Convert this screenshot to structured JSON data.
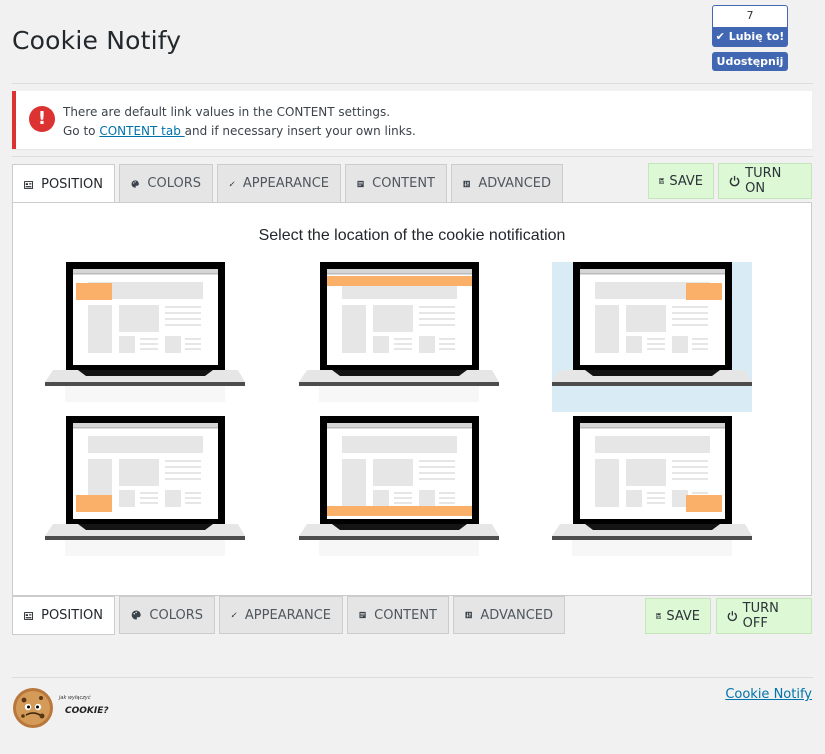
{
  "page": {
    "title": "Cookie Notify"
  },
  "facebook": {
    "count": "7",
    "like_label": "Lubię to!",
    "share_label": "Udostępnij",
    "color": "#4267b2"
  },
  "notice": {
    "line1": "There are default link values in the CONTENT settings.",
    "line2_before": "Go to ",
    "line2_link": "CONTENT tab ",
    "line2_after": "and if necessary insert your own links.",
    "icon": "exclamation-icon"
  },
  "tabs": [
    {
      "label": "POSITION",
      "icon": "position-icon",
      "active": true
    },
    {
      "label": "COLORS",
      "icon": "palette-icon",
      "active": false
    },
    {
      "label": "APPEARANCE",
      "icon": "brush-icon",
      "active": false
    },
    {
      "label": "CONTENT",
      "icon": "content-icon",
      "active": false
    },
    {
      "label": "ADVANCED",
      "icon": "sliders-icon",
      "active": false
    }
  ],
  "top_actions": {
    "save": "SAVE",
    "toggle": "TURN ON"
  },
  "bottom_actions": {
    "save": "SAVE",
    "toggle": "TURN OFF"
  },
  "panel": {
    "title": "Select the location of the cookie notification",
    "options": [
      {
        "position": "top-left",
        "selected": false
      },
      {
        "position": "top-bar",
        "selected": false
      },
      {
        "position": "top-right",
        "selected": true
      },
      {
        "position": "bottom-left",
        "selected": false
      },
      {
        "position": "bottom-bar",
        "selected": false
      },
      {
        "position": "bottom-right",
        "selected": false
      }
    ]
  },
  "colors": {
    "accent": "#fbb06a",
    "selected_bg": "#d9ebf5",
    "save_bg": "#dcf8d5",
    "error": "#dc3232"
  },
  "footer": {
    "logo_text_small": "jak wyłączyć",
    "logo_text_big": "COOKIE?",
    "link": "Cookie Notify"
  }
}
